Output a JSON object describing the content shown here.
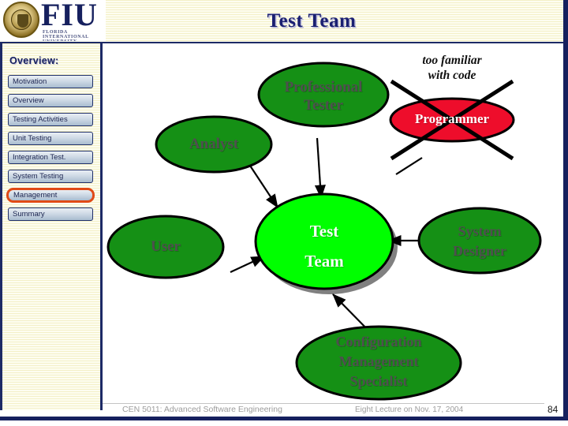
{
  "slide": {
    "title": "Test Team",
    "page_number": "84"
  },
  "branding": {
    "logo_wordmark": "FIU",
    "logo_subtitle": "FLORIDA INTERNATIONAL UNIVERSITY",
    "seal_icon": "university-seal-icon",
    "title_color": "#1a1f71",
    "rule_color": "#1d2a66"
  },
  "sidebar": {
    "heading": "Overview:",
    "selected_index": 6,
    "highlight_color": "#e04a16",
    "items": [
      {
        "label": "Motivation"
      },
      {
        "label": "Overview"
      },
      {
        "label": "Testing Activities"
      },
      {
        "label": "Unit Testing"
      },
      {
        "label": "Integration Test."
      },
      {
        "label": "System Testing"
      },
      {
        "label": "Management"
      },
      {
        "label": "Summary"
      }
    ]
  },
  "diagram": {
    "type": "node-link-diagram",
    "center_color": "#00ff00",
    "role_color": "#159015",
    "excluded_color": "#ee0d2b",
    "nodes": [
      {
        "id": "professional-tester",
        "label": "Professional\nTester",
        "role": "role",
        "excluded": false
      },
      {
        "id": "programmer",
        "label": "Programmer",
        "role": "excluded",
        "excluded": true
      },
      {
        "id": "analyst",
        "label": "Analyst",
        "role": "role",
        "excluded": false
      },
      {
        "id": "user",
        "label": "User",
        "role": "role",
        "excluded": false
      },
      {
        "id": "test-team",
        "label": "Test\nTeam",
        "role": "center",
        "excluded": false
      },
      {
        "id": "system-designer",
        "label": "System\nDesigner",
        "role": "role",
        "excluded": false
      },
      {
        "id": "configuration-management-specialist",
        "label": "Configuration\nManagement\nSpecialist",
        "role": "role",
        "excluded": false
      }
    ],
    "annotations": [
      {
        "id": "programmer-note",
        "text": "too familiar\nwith code"
      }
    ],
    "edges": [
      {
        "from": "professional-tester",
        "to": "test-team"
      },
      {
        "from": "analyst",
        "to": "test-team"
      },
      {
        "from": "user",
        "to": "test-team"
      },
      {
        "from": "system-designer",
        "to": "test-team"
      },
      {
        "from": "configuration-management-specialist",
        "to": "test-team"
      },
      {
        "from": "programmer",
        "to": "test-team"
      }
    ]
  },
  "footer": {
    "course": "CEN 5011: Advanced Software Engineering",
    "lecture": "Eight Lecture on Nov. 17, 2004"
  }
}
